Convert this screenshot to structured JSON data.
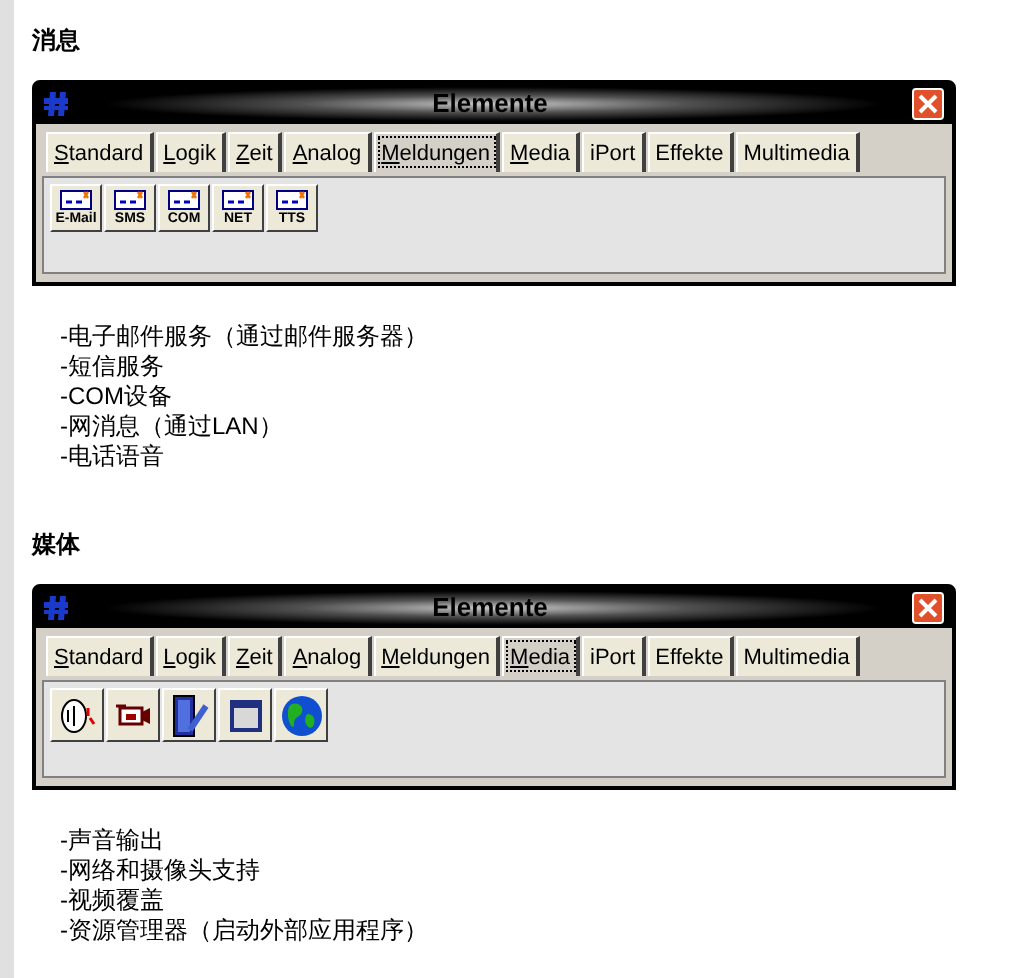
{
  "sections": [
    {
      "heading": "消息",
      "window": {
        "title": "Elemente",
        "tabs": [
          {
            "label": "Standard",
            "mnemonic": true,
            "selected": false
          },
          {
            "label": "Logik",
            "mnemonic": true,
            "selected": false
          },
          {
            "label": "Zeit",
            "mnemonic": true,
            "selected": false
          },
          {
            "label": "Analog",
            "mnemonic": true,
            "selected": false
          },
          {
            "label": "Meldungen",
            "mnemonic": true,
            "selected": true
          },
          {
            "label": "Media",
            "mnemonic": true,
            "selected": false
          },
          {
            "label": "iPort",
            "mnemonic": false,
            "selected": false
          },
          {
            "label": "Effekte",
            "mnemonic": false,
            "selected": false
          },
          {
            "label": "Multimedia",
            "mnemonic": false,
            "selected": false
          }
        ],
        "tools": [
          {
            "kind": "message",
            "label": "E-Mail"
          },
          {
            "kind": "message",
            "label": "SMS"
          },
          {
            "kind": "message",
            "label": "COM"
          },
          {
            "kind": "message",
            "label": "NET"
          },
          {
            "kind": "message",
            "label": "TTS"
          }
        ]
      },
      "items": [
        "-电子邮件服务（通过邮件服务器）",
        "-短信服务",
        "-COM设备",
        "-网消息（通过LAN）",
        "-电话语音"
      ]
    },
    {
      "heading": "媒体",
      "window": {
        "title": "Elemente",
        "tabs": [
          {
            "label": "Standard",
            "mnemonic": true,
            "selected": false
          },
          {
            "label": "Logik",
            "mnemonic": true,
            "selected": false
          },
          {
            "label": "Zeit",
            "mnemonic": true,
            "selected": false
          },
          {
            "label": "Analog",
            "mnemonic": true,
            "selected": false
          },
          {
            "label": "Meldungen",
            "mnemonic": true,
            "selected": false
          },
          {
            "label": "Media",
            "mnemonic": true,
            "selected": true
          },
          {
            "label": "iPort",
            "mnemonic": false,
            "selected": false
          },
          {
            "label": "Effekte",
            "mnemonic": false,
            "selected": false
          },
          {
            "label": "Multimedia",
            "mnemonic": false,
            "selected": false
          }
        ],
        "tools": [
          {
            "kind": "speaker"
          },
          {
            "kind": "camera"
          },
          {
            "kind": "video"
          },
          {
            "kind": "window"
          },
          {
            "kind": "globe"
          }
        ]
      },
      "items": [
        "-声音输出",
        "-网络和摄像头支持",
        "-视频覆盖",
        "-资源管理器（启动外部应用程序）"
      ]
    }
  ]
}
